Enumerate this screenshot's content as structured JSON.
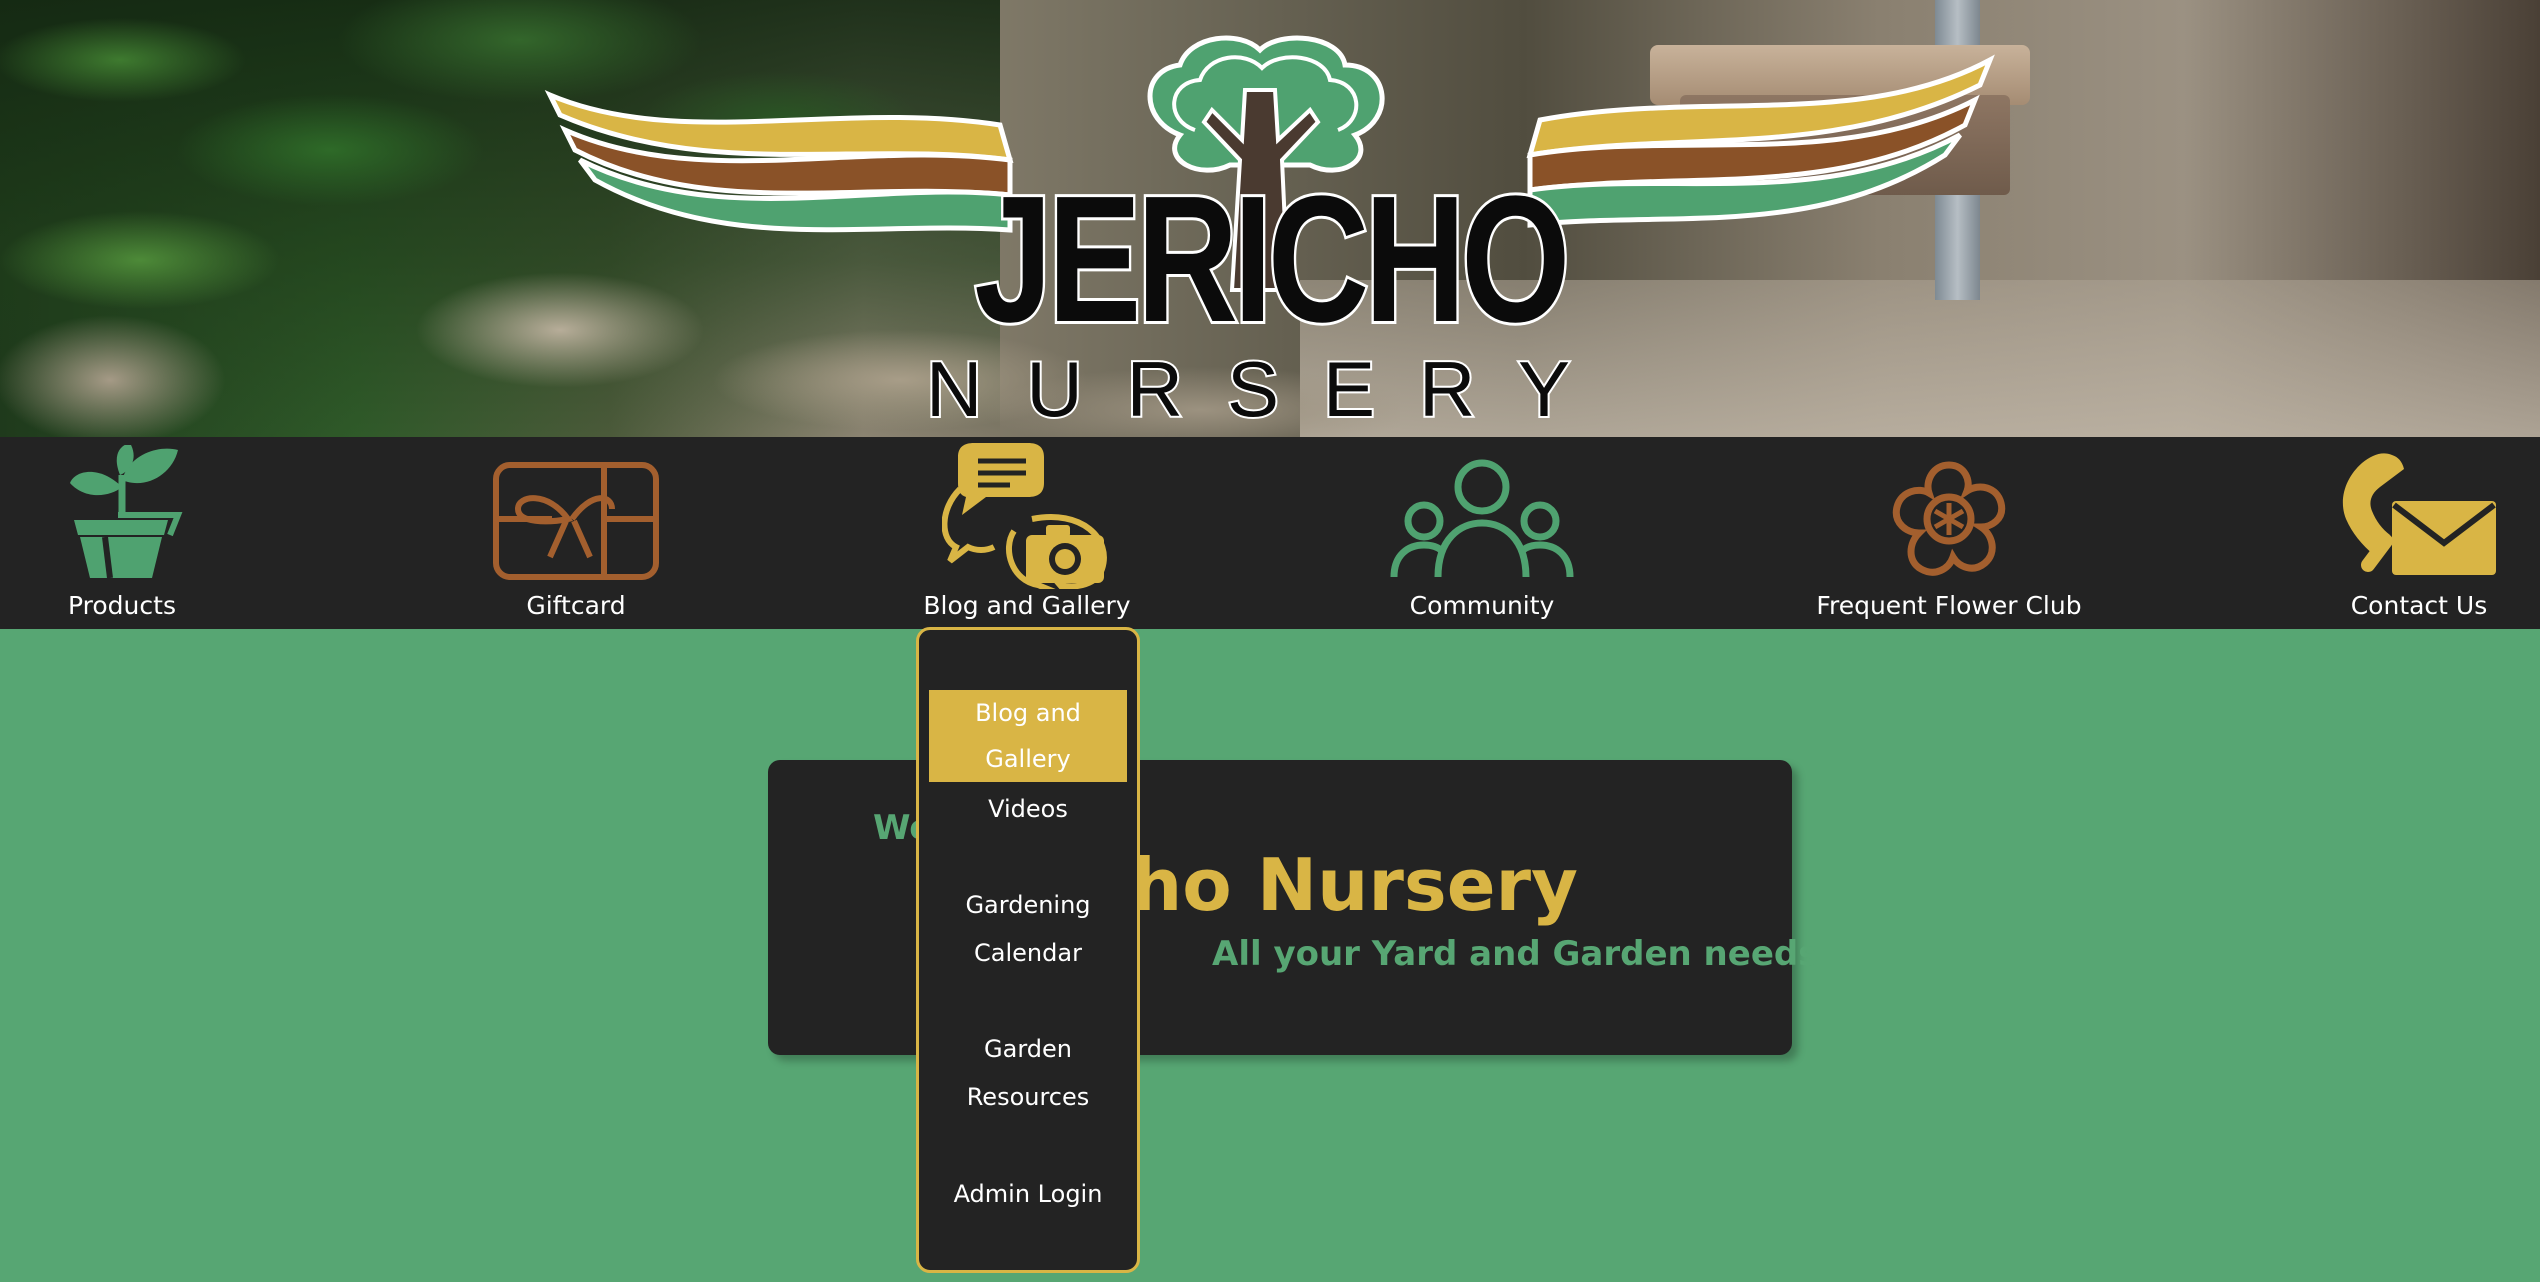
{
  "header": {
    "logo_title": "JERICHO",
    "logo_subtitle": "NURSERY",
    "colors": {
      "gold": "#d9b545",
      "brown": "#8a5228",
      "green": "#4fa270",
      "dark": "#232323"
    }
  },
  "nav": {
    "items": [
      {
        "label": "Products",
        "icon": "potted-plant-icon",
        "color": "#4fa270"
      },
      {
        "label": "Giftcard",
        "icon": "gift-card-icon",
        "color": "#a35f2e"
      },
      {
        "label": "Blog and Gallery",
        "icon": "chat-camera-icon",
        "color": "#d9b545"
      },
      {
        "label": "Community",
        "icon": "people-group-icon",
        "color": "#4fa270"
      },
      {
        "label": "Frequent Flower Club",
        "icon": "flower-icon",
        "color": "#a35f2e"
      },
      {
        "label": "Contact Us",
        "icon": "phone-envelope-icon",
        "color": "#d9b545"
      }
    ]
  },
  "dropdown": {
    "items": [
      {
        "label": "Blog and Gallery",
        "active": true
      },
      {
        "label": "Videos"
      },
      {
        "label": "Gardening Calendar"
      },
      {
        "label": "Garden Resources"
      },
      {
        "label": "Admin Login"
      }
    ]
  },
  "welcome": {
    "line1": "Welcome to",
    "title": "Jericho Nursery",
    "tagline": "All your Yard and Garden needs"
  }
}
